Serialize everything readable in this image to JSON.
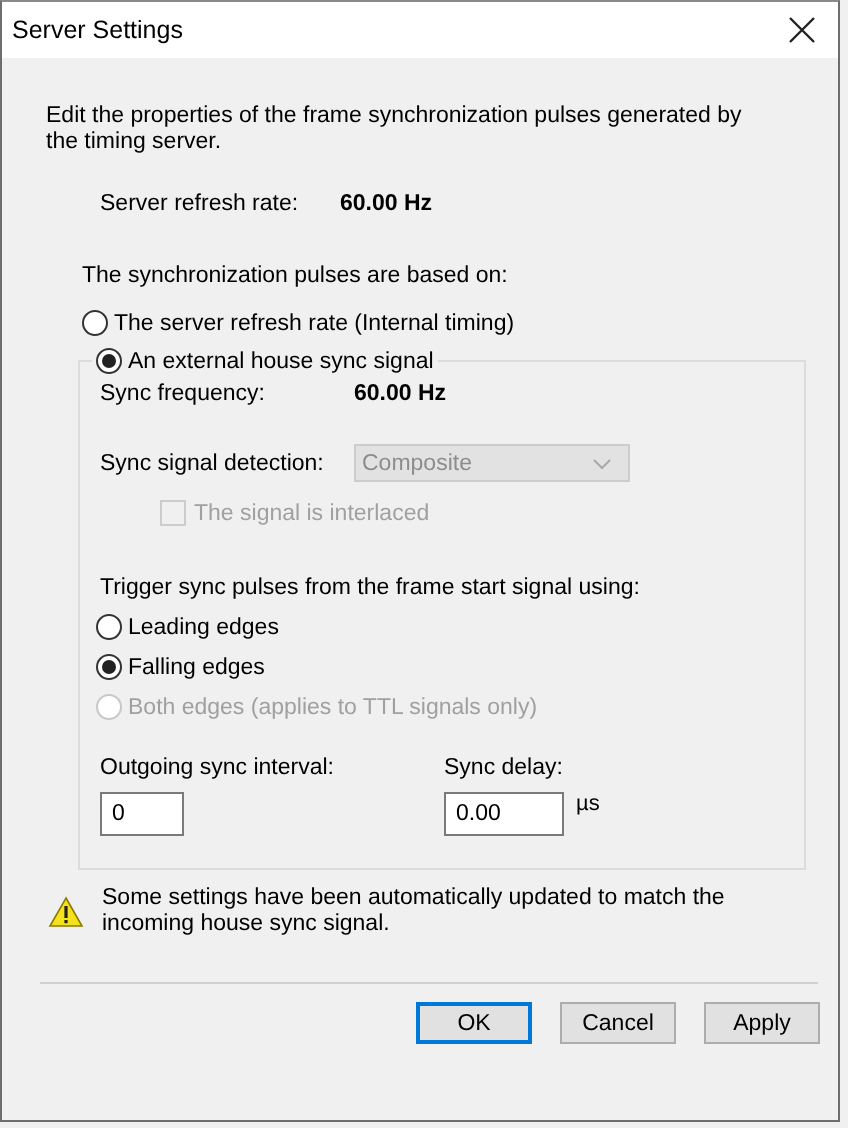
{
  "window": {
    "title": "Server Settings"
  },
  "description": "Edit the properties of the frame synchronization pulses generated by the timing server.",
  "server_refresh_rate": {
    "label": "Server refresh rate:",
    "value": "60.00 Hz"
  },
  "timing_source": {
    "label": "The synchronization pulses are based on:",
    "options": [
      {
        "label": "The server refresh rate (Internal timing)",
        "selected": false
      },
      {
        "label": "An external house sync signal",
        "selected": true
      }
    ]
  },
  "external_sync": {
    "sync_frequency": {
      "label": "Sync frequency:",
      "value": "60.00 Hz"
    },
    "detection": {
      "label": "Sync signal detection:",
      "value": "Composite",
      "disabled": true
    },
    "interlaced": {
      "label": "The signal is interlaced",
      "checked": false,
      "disabled": true
    },
    "trigger": {
      "label": "Trigger sync pulses from the frame start signal using:",
      "options": [
        {
          "label": "Leading edges",
          "selected": false,
          "disabled": false
        },
        {
          "label": "Falling edges",
          "selected": true,
          "disabled": false
        },
        {
          "label": "Both edges (applies to TTL signals only)",
          "selected": false,
          "disabled": true
        }
      ]
    },
    "interval": {
      "label": "Outgoing sync interval:",
      "value": "0"
    },
    "delay": {
      "label": "Sync delay:",
      "value": "0.00",
      "unit": "µs"
    }
  },
  "warning": "Some settings have been automatically updated to match the incoming house sync signal.",
  "buttons": [
    {
      "label": "OK",
      "default": true
    },
    {
      "label": "Cancel",
      "default": false
    },
    {
      "label": "Apply",
      "default": false
    }
  ]
}
